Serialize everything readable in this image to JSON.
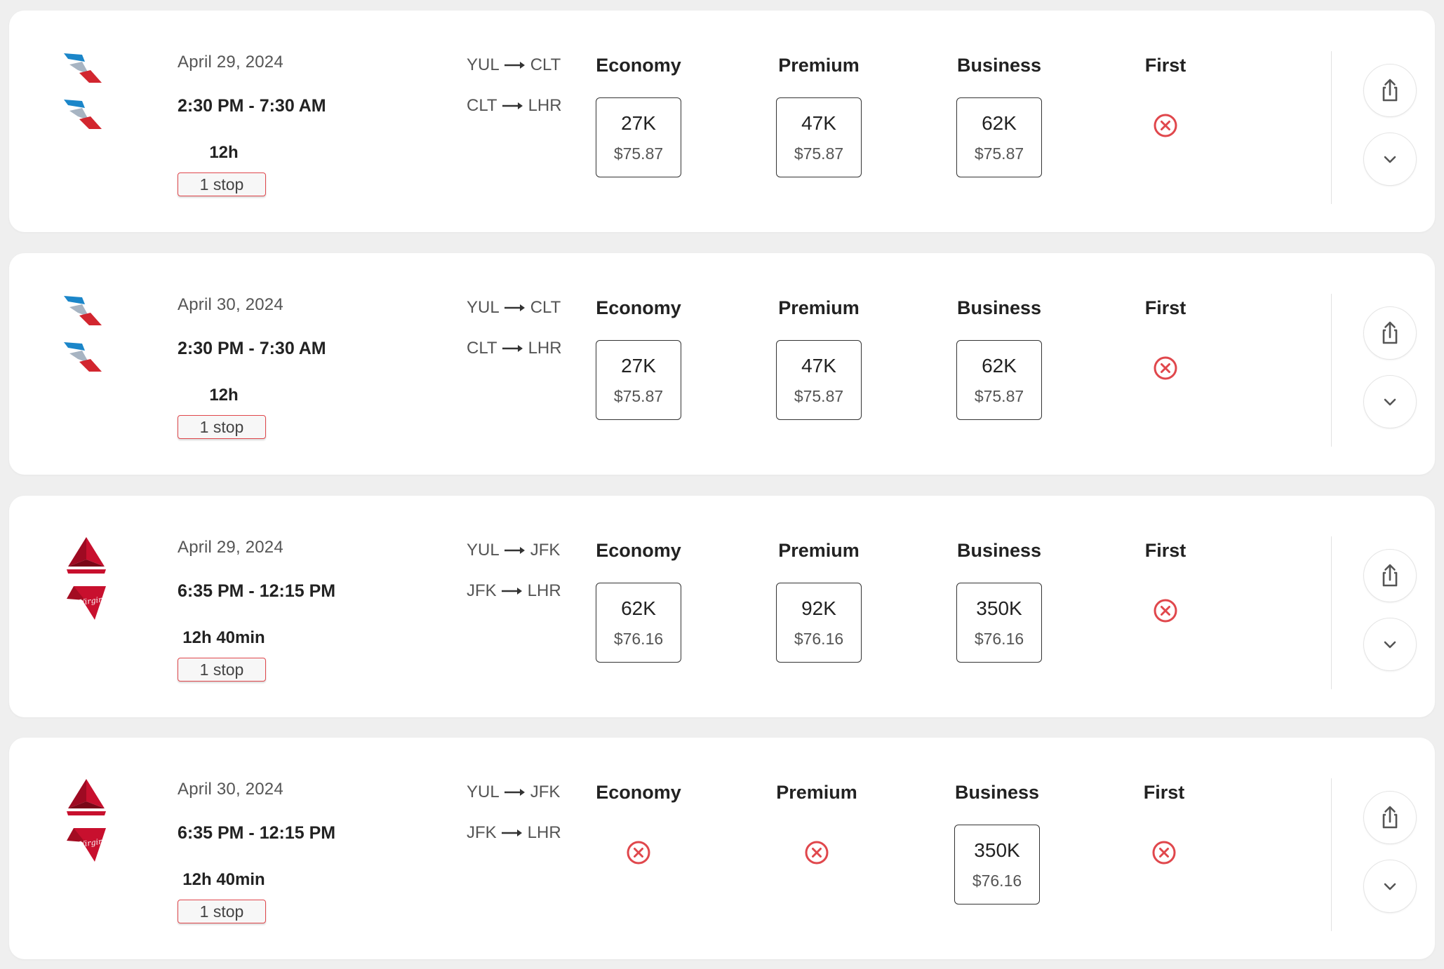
{
  "flights": [
    {
      "airlines": [
        "american-airlines",
        "american-airlines"
      ],
      "date": "April 29, 2024",
      "times": "2:30 PM - 7:30 AM",
      "duration": "12h",
      "stops": "1 stop",
      "segments": [
        {
          "from": "YUL",
          "to": "CLT"
        },
        {
          "from": "CLT",
          "to": "LHR"
        }
      ],
      "cabins": {
        "economy": {
          "label": "Economy",
          "available": true,
          "points": "27K",
          "cash": "$75.87"
        },
        "premium": {
          "label": "Premium",
          "available": true,
          "points": "47K",
          "cash": "$75.87"
        },
        "business": {
          "label": "Business",
          "available": true,
          "points": "62K",
          "cash": "$75.87"
        },
        "first": {
          "label": "First",
          "available": false,
          "points": "",
          "cash": ""
        }
      }
    },
    {
      "airlines": [
        "american-airlines",
        "american-airlines"
      ],
      "date": "April 30, 2024",
      "times": "2:30 PM - 7:30 AM",
      "duration": "12h",
      "stops": "1 stop",
      "segments": [
        {
          "from": "YUL",
          "to": "CLT"
        },
        {
          "from": "CLT",
          "to": "LHR"
        }
      ],
      "cabins": {
        "economy": {
          "label": "Economy",
          "available": true,
          "points": "27K",
          "cash": "$75.87"
        },
        "premium": {
          "label": "Premium",
          "available": true,
          "points": "47K",
          "cash": "$75.87"
        },
        "business": {
          "label": "Business",
          "available": true,
          "points": "62K",
          "cash": "$75.87"
        },
        "first": {
          "label": "First",
          "available": false,
          "points": "",
          "cash": ""
        }
      }
    },
    {
      "airlines": [
        "delta",
        "virgin-atlantic"
      ],
      "date": "April 29, 2024",
      "times": "6:35 PM - 12:15 PM",
      "duration": "12h 40min",
      "stops": "1 stop",
      "segments": [
        {
          "from": "YUL",
          "to": "JFK"
        },
        {
          "from": "JFK",
          "to": "LHR"
        }
      ],
      "cabins": {
        "economy": {
          "label": "Economy",
          "available": true,
          "points": "62K",
          "cash": "$76.16"
        },
        "premium": {
          "label": "Premium",
          "available": true,
          "points": "92K",
          "cash": "$76.16"
        },
        "business": {
          "label": "Business",
          "available": true,
          "points": "350K",
          "cash": "$76.16"
        },
        "first": {
          "label": "First",
          "available": false,
          "points": "",
          "cash": ""
        }
      }
    },
    {
      "airlines": [
        "delta",
        "virgin-atlantic"
      ],
      "date": "April 30, 2024",
      "times": "6:35 PM - 12:15 PM",
      "duration": "12h 40min",
      "stops": "1 stop",
      "segments": [
        {
          "from": "YUL",
          "to": "JFK"
        },
        {
          "from": "JFK",
          "to": "LHR"
        }
      ],
      "cabins": {
        "economy": {
          "label": "Economy",
          "available": false,
          "points": "",
          "cash": ""
        },
        "premium": {
          "label": "Premium",
          "available": false,
          "points": "",
          "cash": ""
        },
        "business": {
          "label": "Business",
          "available": true,
          "points": "350K",
          "cash": "$76.16"
        },
        "first": {
          "label": "First",
          "available": false,
          "points": "",
          "cash": ""
        }
      }
    }
  ],
  "logo_text": {
    "virgin": "Virgin"
  },
  "colors": {
    "unavailable": "#e0474c",
    "stop_border": "#e0474c",
    "aa_red": "#d2262f",
    "aa_blue": "#1b86c9",
    "delta_red": "#c8102e",
    "virgin_red": "#c8102e"
  },
  "icons": {
    "share": "share-icon",
    "expand": "chevron-down-icon",
    "unavailable": "unavailable-x-icon"
  }
}
